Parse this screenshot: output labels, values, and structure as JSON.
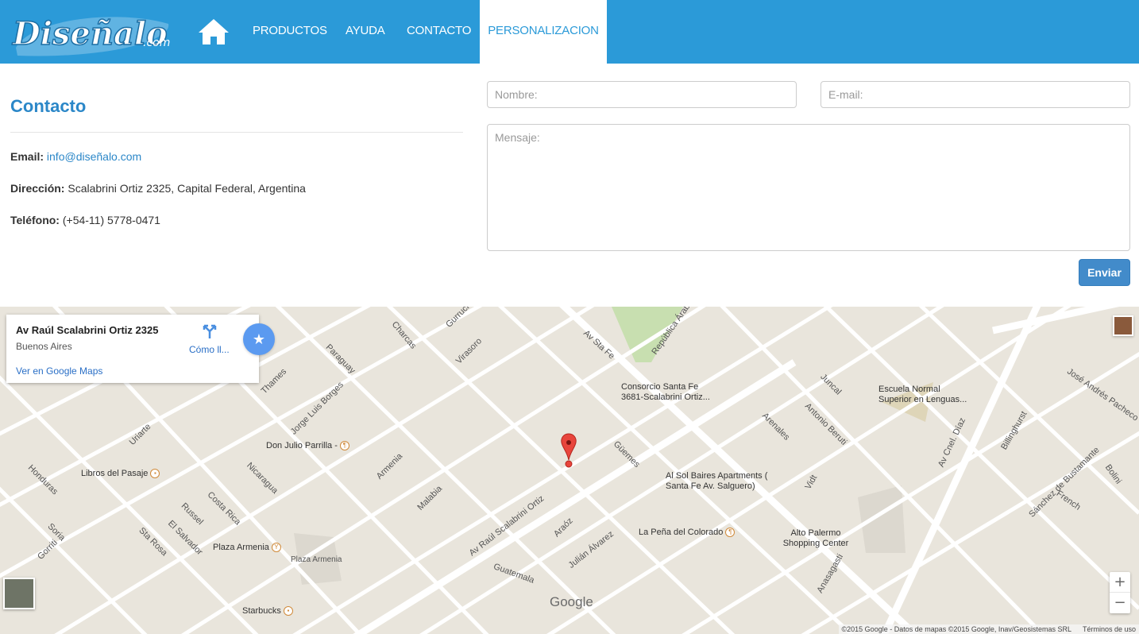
{
  "header": {
    "logo_alt": "Diseñalo.com",
    "nav": [
      {
        "label": "PRODUCTOS"
      },
      {
        "label": "AYUDA"
      },
      {
        "label": "CONTACTO"
      },
      {
        "label": "PERSONALIZACION",
        "active": true
      }
    ],
    "brand_color": "#2b9ad8"
  },
  "contact": {
    "title": "Contacto",
    "email_label": "Email:",
    "email_value": "info@diseñalo.com",
    "address_label": "Dirección:",
    "address_value": "Scalabrini Ortiz 2325, Capital Federal, Argentina",
    "phone_label": "Teléfono:",
    "phone_value": "(+54-11) 5778-0471"
  },
  "form": {
    "name_placeholder": "Nombre:",
    "email_placeholder": "E-mail:",
    "message_placeholder": "Mensaje:",
    "submit_label": "Enviar",
    "submit_color": "#428bca"
  },
  "map": {
    "card": {
      "title": "Av Raúl Scalabrini Ortiz 2325",
      "subtitle": "Buenos Aires",
      "directions_label": "Cómo ll...",
      "link_label": "Ver en Google Maps"
    },
    "street_labels": [
      "Charcas",
      "Gurruchaga",
      "Virasoro",
      "Av Sta Fe",
      "República Árabe",
      "Paraguay",
      "Thames",
      "Jorge Luis Borges",
      "Uriarte",
      "Honduras",
      "Nicaragua",
      "Costa Rica",
      "Russel",
      "El Salvador",
      "Soria",
      "Gorriti",
      "Sta Rosa",
      "Armenia",
      "Malabia",
      "Güemes",
      "Av Raúl Scalabrini Ortiz",
      "Araóz",
      "Julián Álvarez",
      "Guatemala",
      "Juncal",
      "Arenales",
      "Antonio Beruti",
      "Vidt",
      "Anasagasti",
      "Av Cnel. Díaz",
      "Billinghurst",
      "José Andrés Pacheco",
      "Sánchez de Bustamante",
      "Bolini",
      "French"
    ],
    "pois": [
      "Don Julio Parrilla -",
      "Libros del Pasaje",
      "Plaza Armenia",
      "Starbucks",
      "Consorcio Santa Fe 3681-Scalabrini Ortiz...",
      "Al Sol Baires Apartments ( Santa Fe Av. Salguero)",
      "La Peña del Colorado",
      "Alto Palermo Shopping Center",
      "Escuela Normal Superior en Lenguas..."
    ],
    "area_label": "Plaza Armenia",
    "google_logo": "Google",
    "zoom_in": "+",
    "zoom_out": "−",
    "attribution": "©2015 Google - Datos de mapas ©2015 Google, Inav/Geosistemas SRL",
    "terms": "Términos de uso"
  }
}
